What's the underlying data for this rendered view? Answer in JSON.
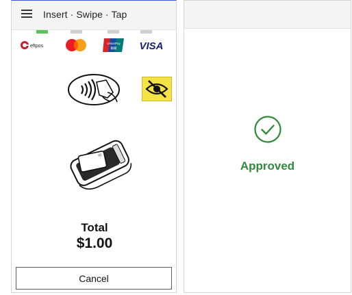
{
  "payment": {
    "title": "Insert · Swipe · Tap",
    "brands": [
      "eftpos",
      "Mastercard",
      "UnionPay",
      "VISA"
    ],
    "brand_text": {
      "eftpos": "eftpos",
      "unionpay": "UnionPay",
      "visa": "VISA"
    },
    "active_indicator_index": 0,
    "total_label": "Total",
    "total_amount": "$1.00",
    "cancel_label": "Cancel"
  },
  "result": {
    "status": "Approved",
    "status_color": "#2e8b3a"
  },
  "colors": {
    "accent_top_border": "#3b55d6",
    "indicator_active": "#58c45a",
    "indicator_inactive": "#cfcfcf",
    "eye_badge": "#f5e244"
  },
  "icons": [
    "menu-icon",
    "contactless-icon",
    "accessibility-eye-icon",
    "card-terminal-icon",
    "check-circle-icon"
  ]
}
